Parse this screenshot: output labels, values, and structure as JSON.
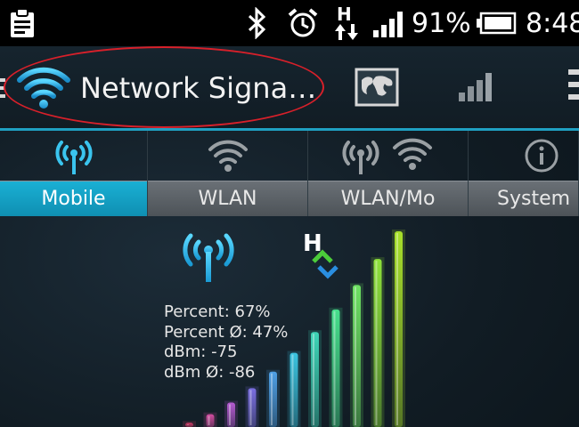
{
  "status_bar": {
    "battery_percent": "91%",
    "time": "8:48",
    "network_type": "H",
    "icons": [
      "clipboard-icon",
      "bluetooth-icon",
      "alarm-icon",
      "h-plus-data-icon",
      "cell-signal-icon",
      "battery-icon"
    ]
  },
  "app_bar": {
    "title": "Network Signa…",
    "icon": "wifi-icon",
    "actions": [
      "map-icon",
      "signal-bars-icon",
      "overflow-menu-icon"
    ]
  },
  "tabs": [
    {
      "label": "Mobile",
      "icon": "cell-tower-icon",
      "active": true
    },
    {
      "label": "WLAN",
      "icon": "wifi-icon",
      "active": false
    },
    {
      "label": "WLAN/Mo",
      "icon": "cell-tower-wifi-icon",
      "active": false
    },
    {
      "label": "System I",
      "icon": "info-icon",
      "active": false
    }
  ],
  "stats": {
    "percent": "Percent: 67%",
    "percent_avg": "Percent Ø: 47%",
    "dbm": "dBm: -75",
    "dbm_avg": "dBm Ø: -86"
  },
  "signal_meter": {
    "level_percent": 67,
    "bar_colors": [
      "#d43c6a",
      "#d24ca0",
      "#b45ad0",
      "#7a6ee0",
      "#4fa0e6",
      "#3ac4e0",
      "#3ed6b8",
      "#46e08c",
      "#6ee262",
      "#8ee23a",
      "#a8e02a"
    ]
  },
  "colors": {
    "accent": "#1ab0d4",
    "active_tab": "#1ab0d4",
    "annotation_oval": "#d8202a"
  }
}
